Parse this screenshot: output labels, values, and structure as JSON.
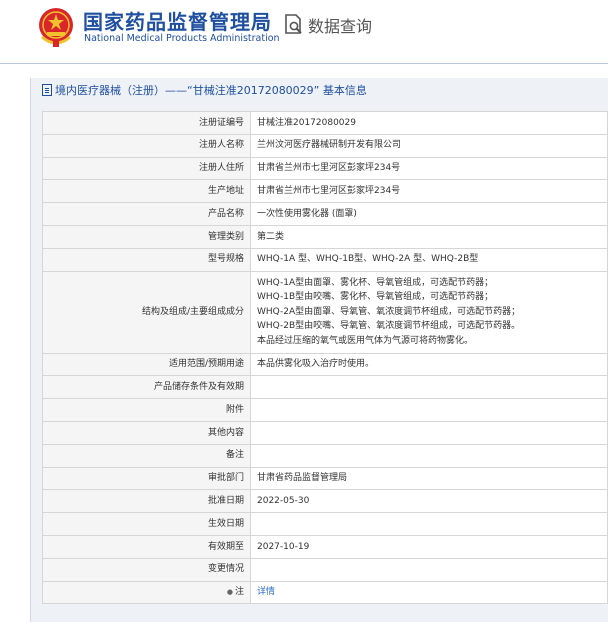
{
  "header": {
    "title_cn": "国家药品监督管理局",
    "title_en": "National Medical Products Administration",
    "search_label": "数据查询",
    "emblem_icon": "national-emblem-icon",
    "search_icon": "document-search-icon",
    "brand_color": "#1f4fa0"
  },
  "panel": {
    "title": "境内医疗器械（注册）——“甘械注准20172080029” 基本信息"
  },
  "rows": [
    {
      "label": "注册证编号",
      "value": "甘械注准20172080029"
    },
    {
      "label": "注册人名称",
      "value": "兰州汶河医疗器械研制开发有限公司"
    },
    {
      "label": "注册人住所",
      "value": "甘肃省兰州市七里河区彭家坪234号"
    },
    {
      "label": "生产地址",
      "value": "甘肃省兰州市七里河区彭家坪234号"
    },
    {
      "label": "产品名称",
      "value": "一次性使用雾化器 (面罩)"
    },
    {
      "label": "管理类别",
      "value": "第二类"
    },
    {
      "label": "型号规格",
      "value": "WHQ-1A 型、WHQ-1B型、WHQ-2A 型、WHQ-2B型"
    },
    {
      "label": "结构及组成/主要组成成分",
      "value_lines": [
        "WHQ-1A型由面罩、雾化杯、导氧管组成，可选配节药器；",
        "WHQ-1B型由咬嘴、雾化杯、导氧管组成，可选配节药器；",
        "WHQ-2A型由面罩、导氧管、氧浓度调节杯组成，可选配节药器；",
        "WHQ-2B型由咬嘴、导氧管、氧浓度调节杯组成，可选配节药器。",
        "本品经过压缩的氧气或医用气体为气源可将药物雾化。"
      ]
    },
    {
      "label": "适用范围/预期用途",
      "value": "本品供雾化吸入治疗时使用。"
    },
    {
      "label": "产品储存条件及有效期",
      "value": ""
    },
    {
      "label": "附件",
      "value": ""
    },
    {
      "label": "其他内容",
      "value": ""
    },
    {
      "label": "备注",
      "value": ""
    },
    {
      "label": "审批部门",
      "value": "甘肃省药品监督管理局"
    },
    {
      "label": "批准日期",
      "value": "2022-05-30"
    },
    {
      "label": "生效日期",
      "value": ""
    },
    {
      "label": "有效期至",
      "value": "2027-10-19"
    },
    {
      "label": "变更情况",
      "value": ""
    },
    {
      "label": "注",
      "label_icon": "bulb-icon",
      "value": "详情",
      "value_is_link": true
    }
  ]
}
